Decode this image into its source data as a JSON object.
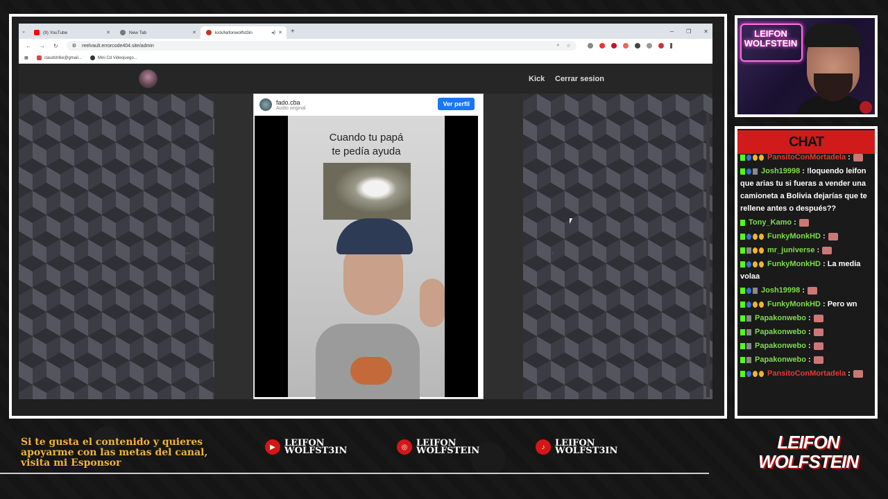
{
  "browser": {
    "tabs": [
      {
        "label": "(9) YouTube",
        "color": "#ff0000"
      },
      {
        "label": "New Tab",
        "color": "#666666"
      },
      {
        "label": "kick/leifonwolfst3in",
        "color": "#c0392b"
      }
    ],
    "url": "reelvault.errorcode404.site/admin",
    "bookmarks": [
      "claudstrike@gmail...",
      "Mini Cd Videojuego..."
    ]
  },
  "site": {
    "nav_kick": "Kick",
    "nav_logout": "Cerrar sesion",
    "reel": {
      "username": "fado.cba",
      "audio": "Audio original",
      "view_profile": "Ver perfil",
      "caption_line1": "Cuando tu papá",
      "caption_line2": "te pedía ayuda"
    }
  },
  "webcam": {
    "neon_line1": "LEIFON",
    "neon_line2": "WOLFSTEIN"
  },
  "chat": {
    "title": "CHAT",
    "messages": [
      {
        "user": "PansitoConMortadela",
        "color": "#e53935",
        "text": ":",
        "badges": [
          "k",
          "s",
          "c",
          "c"
        ]
      },
      {
        "user": "Josh19998",
        "color": "#7ddc4a",
        "text": ": !loquendo leifon que arias tu si fueras a vender una camioneta a Bolivia dejarías que te rellene antes o después??",
        "badges": [
          "k",
          "s",
          "g"
        ]
      },
      {
        "user": "Tony_Kamo",
        "color": "#7ddc4a",
        "text": ":",
        "badges": [
          "k"
        ]
      },
      {
        "user": "FunkyMonkHD",
        "color": "#7ddc4a",
        "text": ":",
        "badges": [
          "k",
          "s",
          "c",
          "c"
        ]
      },
      {
        "user": "mr_juniverse",
        "color": "#7ddc4a",
        "text": ":",
        "badges": [
          "k",
          "g",
          "c",
          "c"
        ]
      },
      {
        "user": "FunkyMonkHD",
        "color": "#7ddc4a",
        "text": ": La media volaa",
        "badges": [
          "k",
          "s",
          "c",
          "c"
        ]
      },
      {
        "user": "Josh19998",
        "color": "#7ddc4a",
        "text": ":",
        "badges": [
          "k",
          "s",
          "g"
        ]
      },
      {
        "user": "FunkyMonkHD",
        "color": "#7ddc4a",
        "text": ": Pero wn",
        "badges": [
          "k",
          "s",
          "c",
          "c"
        ]
      },
      {
        "user": "Papakonwebo",
        "color": "#7ddc4a",
        "text": ":",
        "badges": [
          "k",
          "g"
        ]
      },
      {
        "user": "Papakonwebo",
        "color": "#7ddc4a",
        "text": ":",
        "badges": [
          "k",
          "g"
        ]
      },
      {
        "user": "Papakonwebo",
        "color": "#7ddc4a",
        "text": ":",
        "badges": [
          "k",
          "g"
        ]
      },
      {
        "user": "Papakonwebo",
        "color": "#7ddc4a",
        "text": ":",
        "badges": [
          "k",
          "g"
        ]
      },
      {
        "user": "PansitoConMortadela",
        "color": "#e53935",
        "text": ":",
        "badges": [
          "k",
          "s",
          "c",
          "c"
        ]
      }
    ]
  },
  "overlay": {
    "sponsor_text": "Si te gusta el contenido y quieres apoyarme con las metas del canal, visita mi Esponsor",
    "youtube_line1": "LEIFON",
    "youtube_line2": "WOLFST3IN",
    "instagram_line1": "LEIFON",
    "instagram_line2": "WOLFSTEIN",
    "tiktok_line1": "LEIFON",
    "tiktok_line2": "WOLFST3IN",
    "brand_line1": "LEIFON",
    "brand_line2": "WOLFSTEIN"
  }
}
